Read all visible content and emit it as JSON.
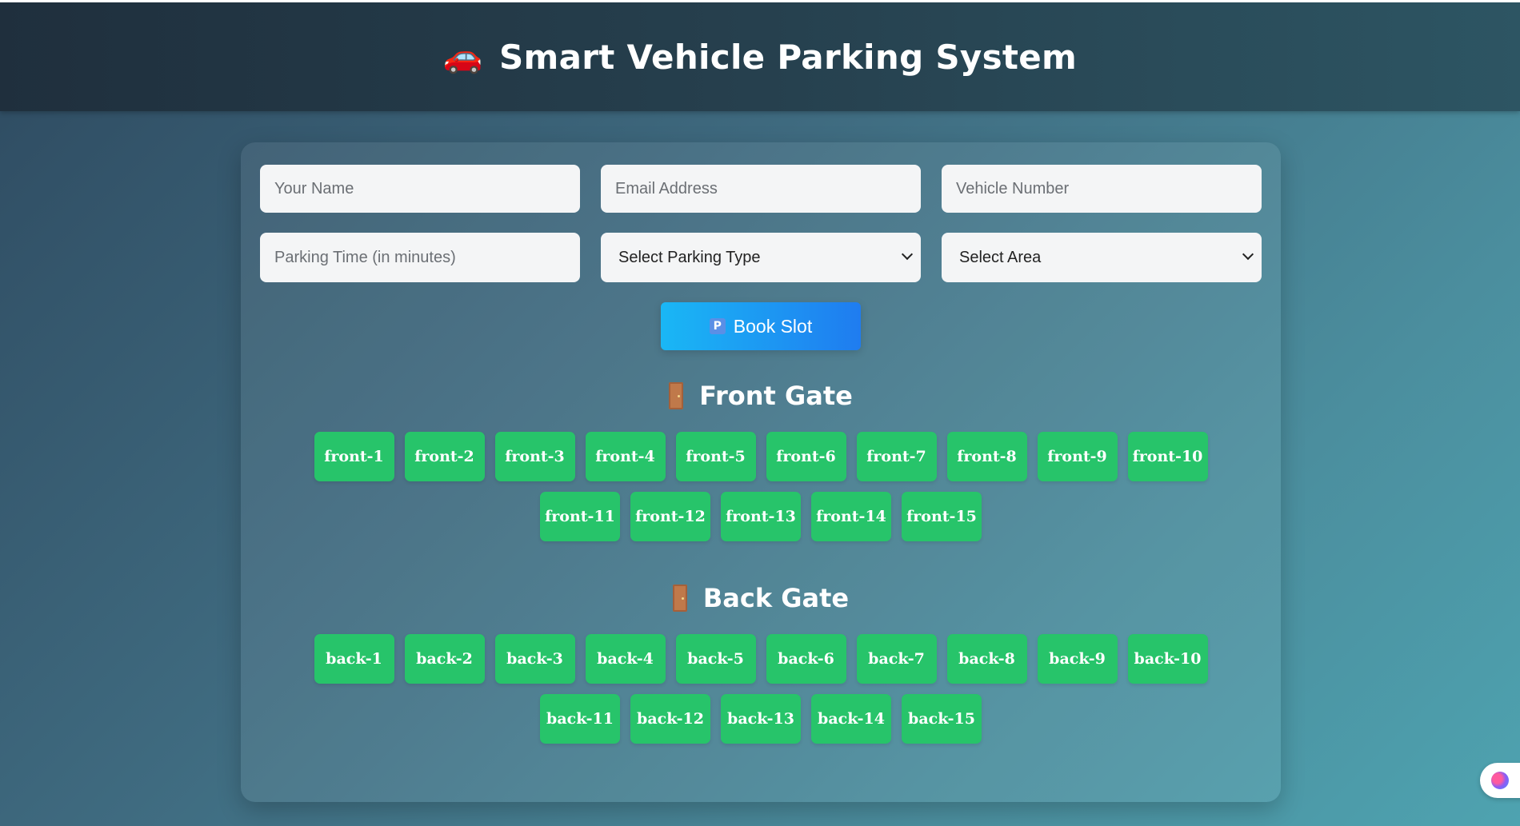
{
  "header": {
    "car_icon": "🚗",
    "title": "Smart Vehicle Parking System"
  },
  "form": {
    "name_placeholder": "Your Name",
    "email_placeholder": "Email Address",
    "vehicle_placeholder": "Vehicle Number",
    "time_placeholder": "Parking Time (in minutes)",
    "parking_type_selected": "Select Parking Type",
    "area_selected": "Select Area",
    "book_icon": "🅿",
    "book_label": "Book Slot"
  },
  "front_gate": {
    "title": "Front Gate",
    "slots": [
      "front-1",
      "front-2",
      "front-3",
      "front-4",
      "front-5",
      "front-6",
      "front-7",
      "front-8",
      "front-9",
      "front-10",
      "front-11",
      "front-12",
      "front-13",
      "front-14",
      "front-15"
    ]
  },
  "back_gate": {
    "title": "Back Gate",
    "slots": [
      "back-1",
      "back-2",
      "back-3",
      "back-4",
      "back-5",
      "back-6",
      "back-7",
      "back-8",
      "back-9",
      "back-10",
      "back-11",
      "back-12",
      "back-13",
      "back-14",
      "back-15"
    ]
  },
  "colors": {
    "slot_available": "#27c46a",
    "book_button_start": "#1ab7f5",
    "book_button_end": "#1f7cf0"
  },
  "icons": {
    "title_icon": "car-icon",
    "gate_icon": "door-icon",
    "book_icon": "parking-icon",
    "floating_icon": "brain-icon"
  }
}
